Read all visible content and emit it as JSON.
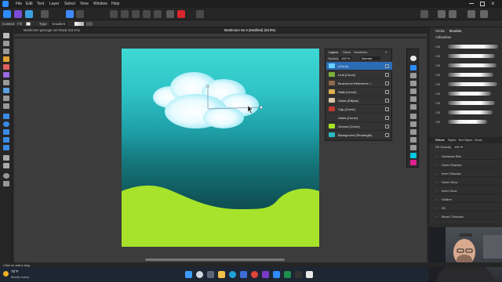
{
  "menu": {
    "items": [
      "File",
      "Edit",
      "Text",
      "Layer",
      "Select",
      "View",
      "Window",
      "Help"
    ]
  },
  "context": {
    "label_context": "Context",
    "fill_label": "Fill",
    "type_label": "Type",
    "type_value": "Gradient"
  },
  "tabs": [
    "Mushroom garnage-cel-shade (63.4%)",
    "Mushroom No 5 (Modified) (63.8%)"
  ],
  "layers": {
    "tabs": [
      "Layers",
      "Stock",
      "Swatches"
    ],
    "opacity_label": "Opacity",
    "opacity_value": "100 %",
    "blend_value": "Normal",
    "rows": [
      {
        "name": "(Cloud)",
        "color": "#6ad0ff"
      },
      {
        "name": "Leaf (Curve)",
        "color": "#7ab33c"
      },
      {
        "name": "Mushroom Reference i...",
        "color": "#8f6a4d"
      },
      {
        "name": "Stalk (Curve)",
        "color": "#e0b050"
      },
      {
        "name": "Gates (Ellipse)",
        "color": "#d7c6a8"
      },
      {
        "name": "Cap (Curve)",
        "color": "#c0392b"
      },
      {
        "name": "Gates (Curve)",
        "color": "#333333"
      },
      {
        "name": "Ground (Curve)",
        "color": "#a8e624"
      },
      {
        "name": "Background (Rectangle)",
        "color": "#2bb8c0"
      }
    ]
  },
  "right_panel": {
    "tabs": [
      "Stroke",
      "Brushes"
    ],
    "brushes_category": "Airbrushes",
    "brush_sizes": [
      "128",
      "128",
      "128",
      "128",
      "128",
      "128",
      "128",
      "128",
      "128"
    ],
    "effects_tabs": [
      "Effects",
      "Styles",
      "Text Styles",
      "Stock"
    ],
    "fill_opacity_label": "Fill Opacity",
    "fill_opacity_value": "100 %",
    "effects": [
      "Gaussian Blur",
      "Outer Shadow",
      "Inner Shadow",
      "Outer Glow",
      "Inner Glow",
      "Outline",
      "3D",
      "Bevel / Emboss"
    ]
  },
  "status": {
    "hint": "Click on add a stop.",
    "weather_temp": "76°F",
    "weather_desc": "Mostly sunny"
  },
  "colors": {
    "accent": "#2d8cff",
    "ground": "#a6e32a",
    "sky_top": "#3ed9d4",
    "sky_bottom": "#0c3f42"
  }
}
